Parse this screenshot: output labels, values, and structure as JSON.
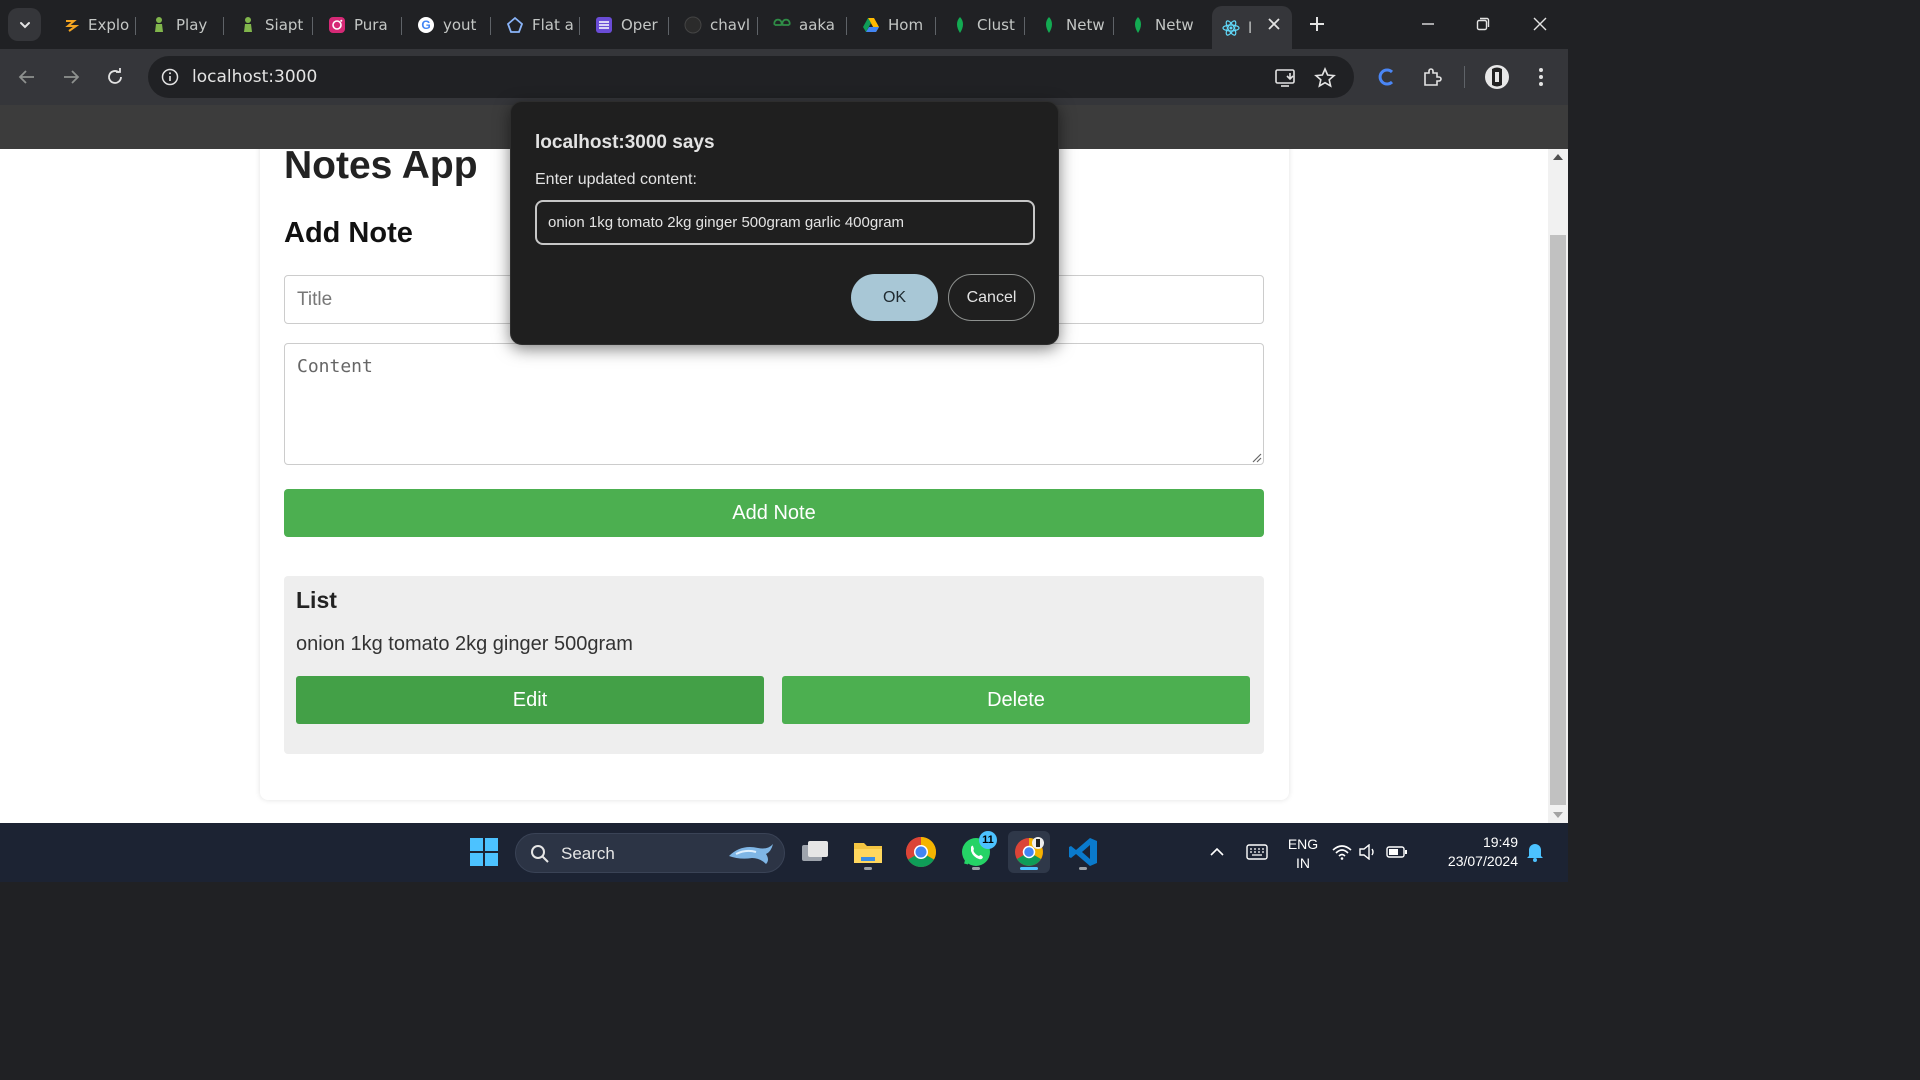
{
  "browser": {
    "tabs": [
      {
        "label": "Explo",
        "icon": "cursor-ai-icon"
      },
      {
        "label": "Play",
        "icon": "chess-pawn-icon"
      },
      {
        "label": "Siapt",
        "icon": "chess-pawn-icon"
      },
      {
        "label": "Pura",
        "icon": "instagram-icon"
      },
      {
        "label": "yout",
        "icon": "google-icon"
      },
      {
        "label": "Flat a",
        "icon": "flat-icon"
      },
      {
        "label": "Oper",
        "icon": "list-icon"
      },
      {
        "label": "chavl",
        "icon": "github-icon"
      },
      {
        "label": "aaka",
        "icon": "geeksforgeeks-icon"
      },
      {
        "label": "Hom",
        "icon": "google-drive-icon"
      },
      {
        "label": "Clust",
        "icon": "mongodb-leaf-icon"
      },
      {
        "label": "Netw",
        "icon": "mongodb-leaf-icon"
      },
      {
        "label": "Netw",
        "icon": "mongodb-leaf-icon"
      },
      {
        "label": "l",
        "icon": "react-icon",
        "active": true
      }
    ],
    "url": "localhost:3000"
  },
  "page": {
    "app_title": "Notes App",
    "section_title": "Add Note",
    "title_placeholder": "Title",
    "content_placeholder": "Content",
    "add_button": "Add Note",
    "list_title": "List",
    "notes": [
      {
        "content": "onion 1kg tomato 2kg ginger 500gram",
        "edit_label": "Edit",
        "delete_label": "Delete"
      }
    ]
  },
  "dialog": {
    "title": "localhost:3000 says",
    "message": "Enter updated content:",
    "input_value": "onion 1kg tomato 2kg ginger 500gram garlic 400gram",
    "ok_label": "OK",
    "cancel_label": "Cancel"
  },
  "taskbar": {
    "search_label": "Search",
    "whatsapp_badge": "11",
    "language_line1": "ENG",
    "language_line2": "IN",
    "time": "19:49",
    "date": "23/07/2024"
  },
  "colors": {
    "accent_green": "#4caf50",
    "dialog_ok": "#a8c7d6",
    "taskbar": "#1c2333"
  }
}
